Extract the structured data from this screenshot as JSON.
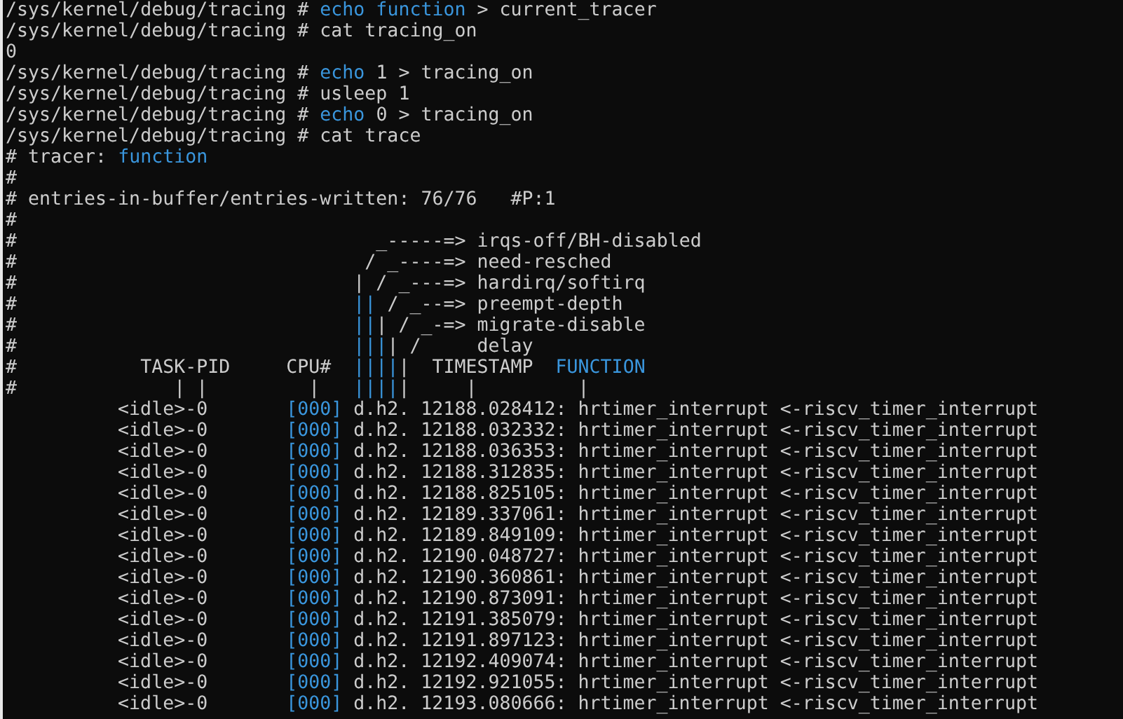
{
  "lines": [
    {
      "segments": [
        {
          "text": "/sys/kernel/debug/tracing # ",
          "highlight": false
        },
        {
          "text": "echo function",
          "highlight": true
        },
        {
          "text": " > current_tracer",
          "highlight": false
        }
      ]
    },
    {
      "segments": [
        {
          "text": "/sys/kernel/debug/tracing # cat tracing_on",
          "highlight": false
        }
      ]
    },
    {
      "segments": [
        {
          "text": "0",
          "highlight": false
        }
      ]
    },
    {
      "segments": [
        {
          "text": "/sys/kernel/debug/tracing # ",
          "highlight": false
        },
        {
          "text": "echo",
          "highlight": true
        },
        {
          "text": " 1 > tracing_on",
          "highlight": false
        }
      ]
    },
    {
      "segments": [
        {
          "text": "/sys/kernel/debug/tracing # usleep 1",
          "highlight": false
        }
      ]
    },
    {
      "segments": [
        {
          "text": "/sys/kernel/debug/tracing # ",
          "highlight": false
        },
        {
          "text": "echo",
          "highlight": true
        },
        {
          "text": " 0 > tracing_on",
          "highlight": false
        }
      ]
    },
    {
      "segments": [
        {
          "text": "/sys/kernel/debug/tracing # cat trace",
          "highlight": false
        }
      ]
    },
    {
      "segments": [
        {
          "text": "# tracer: ",
          "highlight": false
        },
        {
          "text": "function",
          "highlight": true
        }
      ]
    },
    {
      "segments": [
        {
          "text": "#",
          "highlight": false
        }
      ]
    },
    {
      "segments": [
        {
          "text": "# entries-in-buffer/entries-written: 76/76   #P:1",
          "highlight": false
        }
      ]
    },
    {
      "segments": [
        {
          "text": "#",
          "highlight": false
        }
      ]
    },
    {
      "segments": [
        {
          "text": "#                                _-----=> irqs-off/BH-disabled",
          "highlight": false
        }
      ]
    },
    {
      "segments": [
        {
          "text": "#                               / _----=> need-resched",
          "highlight": false
        }
      ]
    },
    {
      "segments": [
        {
          "text": "#                              | / _---=> hardirq/softirq",
          "highlight": false
        }
      ]
    },
    {
      "segments": [
        {
          "text": "#                              ",
          "highlight": false
        },
        {
          "text": "||",
          "highlight": true
        },
        {
          "text": " / _--=> preempt-depth",
          "highlight": false
        }
      ]
    },
    {
      "segments": [
        {
          "text": "#                              ",
          "highlight": false
        },
        {
          "text": "||",
          "highlight": true
        },
        {
          "text": "| / _-=> migrate-disable",
          "highlight": false
        }
      ]
    },
    {
      "segments": [
        {
          "text": "#                              ",
          "highlight": false
        },
        {
          "text": "|||",
          "highlight": true
        },
        {
          "text": "| /     delay",
          "highlight": false
        }
      ]
    },
    {
      "segments": [
        {
          "text": "#           TASK-PID     CPU#  ",
          "highlight": false
        },
        {
          "text": "||||",
          "highlight": true
        },
        {
          "text": "|  TIMESTAMP  ",
          "highlight": false
        },
        {
          "text": "FUNCTION",
          "highlight": true
        }
      ]
    },
    {
      "segments": [
        {
          "text": "#              | |         |   ",
          "highlight": false
        },
        {
          "text": "||||",
          "highlight": true
        },
        {
          "text": "|     |         |",
          "highlight": false
        }
      ]
    }
  ],
  "trace_rows": [
    {
      "task": "<idle>-0",
      "cpu": "[000]",
      "flags": "d.h2.",
      "timestamp": "12188.028412:",
      "function": "hrtimer_interrupt",
      "caller": "<-riscv_timer_interrupt"
    },
    {
      "task": "<idle>-0",
      "cpu": "[000]",
      "flags": "d.h2.",
      "timestamp": "12188.032332:",
      "function": "hrtimer_interrupt",
      "caller": "<-riscv_timer_interrupt"
    },
    {
      "task": "<idle>-0",
      "cpu": "[000]",
      "flags": "d.h2.",
      "timestamp": "12188.036353:",
      "function": "hrtimer_interrupt",
      "caller": "<-riscv_timer_interrupt"
    },
    {
      "task": "<idle>-0",
      "cpu": "[000]",
      "flags": "d.h2.",
      "timestamp": "12188.312835:",
      "function": "hrtimer_interrupt",
      "caller": "<-riscv_timer_interrupt"
    },
    {
      "task": "<idle>-0",
      "cpu": "[000]",
      "flags": "d.h2.",
      "timestamp": "12188.825105:",
      "function": "hrtimer_interrupt",
      "caller": "<-riscv_timer_interrupt"
    },
    {
      "task": "<idle>-0",
      "cpu": "[000]",
      "flags": "d.h2.",
      "timestamp": "12189.337061:",
      "function": "hrtimer_interrupt",
      "caller": "<-riscv_timer_interrupt"
    },
    {
      "task": "<idle>-0",
      "cpu": "[000]",
      "flags": "d.h2.",
      "timestamp": "12189.849109:",
      "function": "hrtimer_interrupt",
      "caller": "<-riscv_timer_interrupt"
    },
    {
      "task": "<idle>-0",
      "cpu": "[000]",
      "flags": "d.h2.",
      "timestamp": "12190.048727:",
      "function": "hrtimer_interrupt",
      "caller": "<-riscv_timer_interrupt"
    },
    {
      "task": "<idle>-0",
      "cpu": "[000]",
      "flags": "d.h2.",
      "timestamp": "12190.360861:",
      "function": "hrtimer_interrupt",
      "caller": "<-riscv_timer_interrupt"
    },
    {
      "task": "<idle>-0",
      "cpu": "[000]",
      "flags": "d.h2.",
      "timestamp": "12190.873091:",
      "function": "hrtimer_interrupt",
      "caller": "<-riscv_timer_interrupt"
    },
    {
      "task": "<idle>-0",
      "cpu": "[000]",
      "flags": "d.h2.",
      "timestamp": "12191.385079:",
      "function": "hrtimer_interrupt",
      "caller": "<-riscv_timer_interrupt"
    },
    {
      "task": "<idle>-0",
      "cpu": "[000]",
      "flags": "d.h2.",
      "timestamp": "12191.897123:",
      "function": "hrtimer_interrupt",
      "caller": "<-riscv_timer_interrupt"
    },
    {
      "task": "<idle>-0",
      "cpu": "[000]",
      "flags": "d.h2.",
      "timestamp": "12192.409074:",
      "function": "hrtimer_interrupt",
      "caller": "<-riscv_timer_interrupt"
    },
    {
      "task": "<idle>-0",
      "cpu": "[000]",
      "flags": "d.h2.",
      "timestamp": "12192.921055:",
      "function": "hrtimer_interrupt",
      "caller": "<-riscv_timer_interrupt"
    },
    {
      "task": "<idle>-0",
      "cpu": "[000]",
      "flags": "d.h2.",
      "timestamp": "12193.080666:",
      "function": "hrtimer_interrupt",
      "caller": "<-riscv_timer_interrupt"
    }
  ]
}
